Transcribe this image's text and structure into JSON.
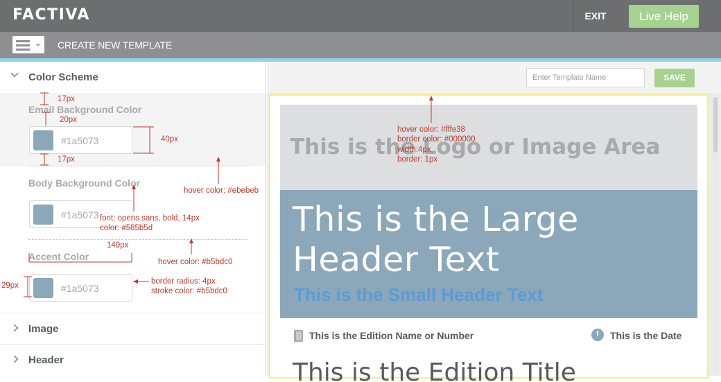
{
  "app": {
    "logo": "FACTIVA",
    "exit_label": "EXIT",
    "live_help_label": "Live Help"
  },
  "subheader": {
    "title": "CREATE NEW TEMPLATE",
    "menu_icon": "hamburger-menu-icon"
  },
  "sidebar": {
    "sections": [
      {
        "label": "Color Scheme",
        "expanded": true
      },
      {
        "label": "Image",
        "expanded": false
      },
      {
        "label": "Header",
        "expanded": false
      }
    ],
    "color_fields": [
      {
        "label": "Email Background Color",
        "value": "#1a5073",
        "swatch": "#8ba7ba"
      },
      {
        "label": "Body Background Color",
        "value": "#1a5073",
        "swatch": "#8ba7ba"
      },
      {
        "label": "Accent Color",
        "value": "#1a5073",
        "swatch": "#8ba7ba"
      }
    ]
  },
  "toolbar": {
    "template_name_placeholder": "Enter Template Name",
    "save_label": "SAVE"
  },
  "preview": {
    "logo_area_text": "This is the Logo or Image Area",
    "large_header_text": "This is the Large Header Text",
    "small_header_text": "This is the Small Header Text",
    "edition_text": "This is the Edition Name or Number",
    "date_text": "This is the Date",
    "edition_title_text": "This is the Edition Title"
  },
  "annotations": {
    "a17top": "17px",
    "a20": "20px",
    "a40": "40px",
    "a17bot": "17px",
    "hover1": "hover color: #ebebeb",
    "font_line1": "font: opens sans, bold, 14px",
    "font_line2": "color: #585b5d",
    "a149": "149px",
    "hover2": "hover color: #b5bdc0",
    "a29": "29px",
    "radius_line1": "border radius: 4px",
    "radius_line2": "stroke color: #b5bdc0",
    "preview_line1": "hover color: #fffe38",
    "preview_line2": "border color: #000000",
    "preview_line3": "width:4px",
    "preview_line4": "border: 1px"
  },
  "colors": {
    "accent_green": "#a5d38f",
    "header_blue": "#8ba7ba",
    "small_header_blue": "#5b9bd5",
    "annotation_red": "#c0392b",
    "text_gray": "#585b5d"
  }
}
